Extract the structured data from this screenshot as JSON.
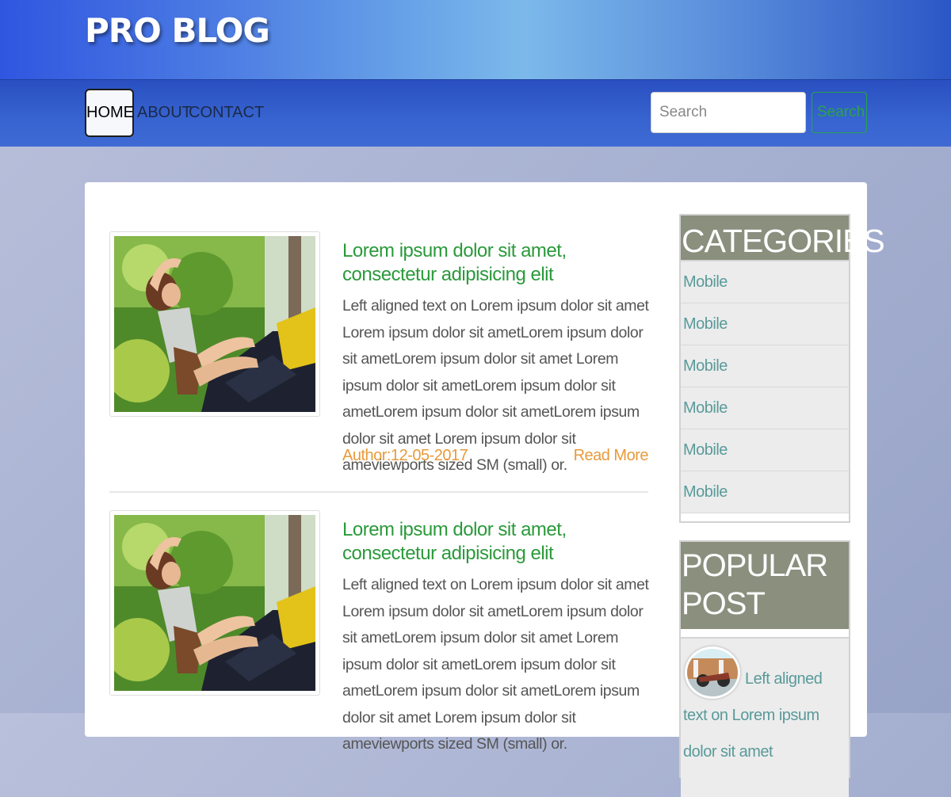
{
  "site": {
    "logo": "PRO BLOG"
  },
  "nav": {
    "items": [
      {
        "label": "HOME",
        "active": true
      },
      {
        "label": "ABOUT",
        "active": false
      },
      {
        "label": "CONTACT",
        "active": false
      }
    ],
    "search": {
      "placeholder": "Search",
      "value": "",
      "button_label": "Search"
    }
  },
  "posts": [
    {
      "title": "Lorem ipsum dolor sit amet, consectetur adipisicing elit",
      "text": "Left aligned text on Lorem ipsum dolor sit amet Lorem ipsum dolor sit ametLorem ipsum dolor sit ametLorem ipsum dolor sit amet Lorem ipsum dolor sit ametLorem ipsum dolor sit ametLorem ipsum dolor sit ametLorem ipsum dolor sit amet Lorem ipsum dolor sit ameviewports sized SM (small) or.",
      "author": "Author:12-05-2017",
      "read_more": "Read More"
    },
    {
      "title": "Lorem ipsum dolor sit amet, consectetur adipisicing elit",
      "text": "Left aligned text on Lorem ipsum dolor sit amet Lorem ipsum dolor sit ametLorem ipsum dolor sit ametLorem ipsum dolor sit amet Lorem ipsum dolor sit ametLorem ipsum dolor sit ametLorem ipsum dolor sit ametLorem ipsum dolor sit amet Lorem ipsum dolor sit ameviewports sized SM (small) or.",
      "author": "",
      "read_more": ""
    }
  ],
  "sidebar": {
    "categories": {
      "heading": "CATEGORIES",
      "items": [
        "Mobile",
        "Mobile",
        "Mobile",
        "Mobile",
        "Mobile",
        "Mobile"
      ]
    },
    "popular": {
      "heading": "POPULAR POST",
      "items": [
        {
          "text": "Left aligned text on Lorem ipsum dolor sit amet"
        }
      ]
    }
  },
  "colors": {
    "accent_green": "#2a9a3a",
    "meta_orange": "#e89a3a",
    "sidebar_link": "#5a9a9a",
    "widget_heading_bg": "#8a8f7e"
  }
}
